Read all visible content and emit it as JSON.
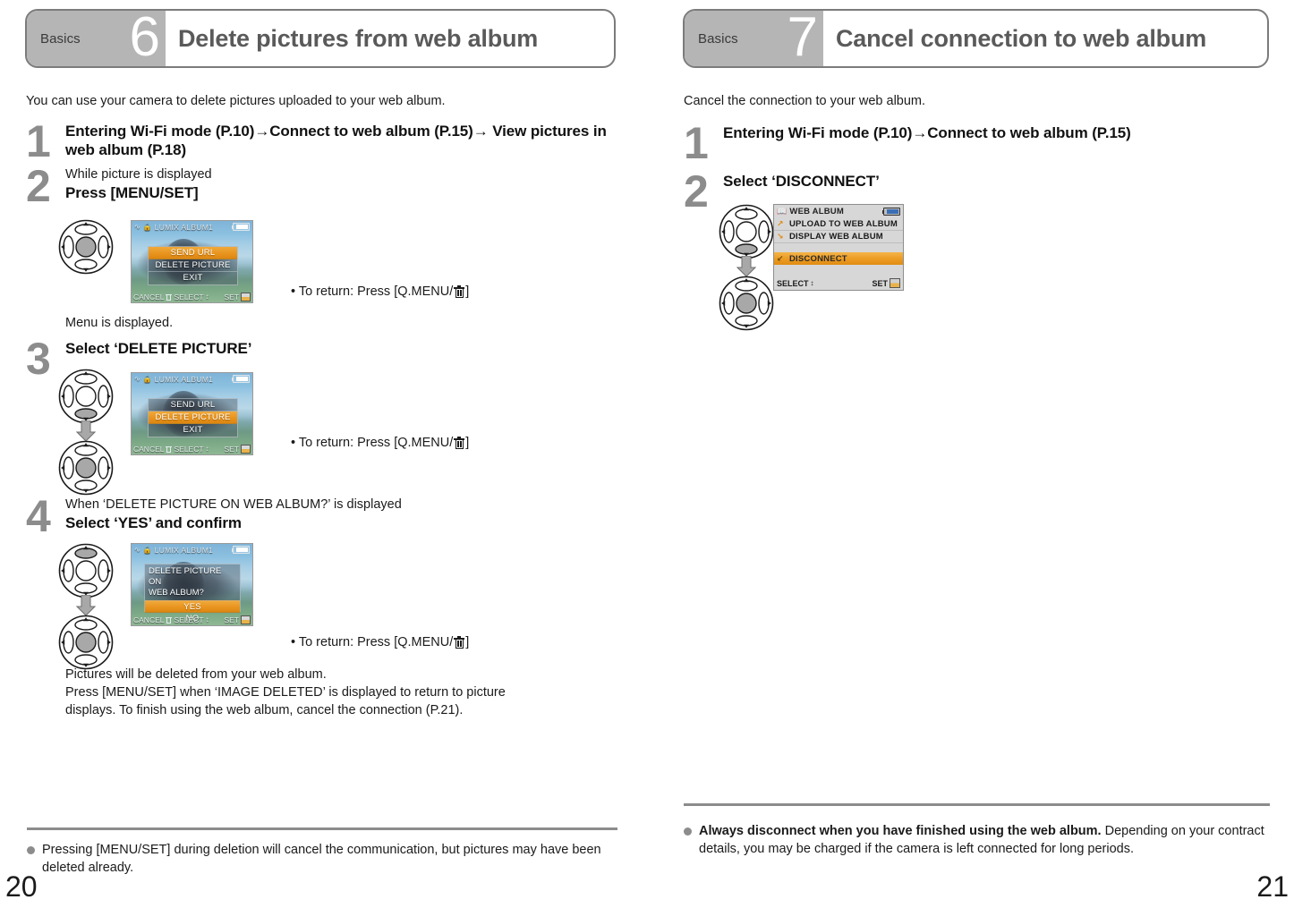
{
  "left_page": {
    "banner": {
      "category": "Basics",
      "number": "6",
      "title": "Delete pictures from web album"
    },
    "intro": "You can use your camera to delete pictures uploaded to your web album.",
    "steps": [
      {
        "num": "1",
        "sub": "",
        "main": "Entering Wi-Fi mode (P.10)→Connect to web album (P.15)→ View pictures in web album (P.18)"
      },
      {
        "num": "2",
        "sub": "While picture is displayed",
        "main": "Press [MENU/SET]"
      },
      {
        "num": "3",
        "sub": "",
        "main": "Select ‘DELETE PICTURE’"
      },
      {
        "num": "4",
        "sub": "When ‘DELETE PICTURE ON WEB ALBUM?’ is displayed",
        "main": "Select ‘YES’ and confirm"
      }
    ],
    "after_step2_note": "Menu is displayed.",
    "return_notes": [
      "• To return: Press [Q.MENU/",
      "• To return: Press [Q.MENU/",
      "• To return: Press [Q.MENU/"
    ],
    "return_note_tail": "]",
    "closing_lines": [
      "Pictures will be deleted from your web album.",
      "Press [MENU/SET] when ‘IMAGE DELETED’ is displayed to return to picture",
      "displays. To finish using the web album, cancel the connection (P.21)."
    ],
    "footer_note": {
      "strong": "",
      "text": "Pressing [MENU/SET] during deletion will cancel the communication, but pictures may have been deleted already."
    },
    "page_number": "20",
    "lcd_menu": {
      "title": "LUMIX ALBUM1",
      "items": [
        "SEND URL",
        "DELETE PICTURE",
        "EXIT"
      ],
      "selected_step2": "SEND URL",
      "selected_step3": "DELETE PICTURE",
      "bottom_cancel": "CANCEL",
      "bottom_select": "SELECT",
      "bottom_set": "SET"
    },
    "lcd_confirm": {
      "title": "LUMIX ALBUM1",
      "question_line1": "DELETE PICTURE ON",
      "question_line2": "WEB ALBUM?",
      "options": [
        "YES",
        "NO"
      ],
      "selected": "YES",
      "bottom_cancel": "CANCEL",
      "bottom_select": "SELECT",
      "bottom_set": "SET"
    }
  },
  "right_page": {
    "banner": {
      "category": "Basics",
      "number": "7",
      "title": "Cancel connection to web album"
    },
    "intro": "Cancel the connection to your web album.",
    "steps": [
      {
        "num": "1",
        "sub": "",
        "main": "Entering Wi-Fi mode (P.10)→Connect to web album (P.15)"
      },
      {
        "num": "2",
        "sub": "",
        "main": "Select ‘DISCONNECT’"
      }
    ],
    "lcd_menu": {
      "title": "WEB ALBUM",
      "rows": [
        "UPLOAD TO WEB ALBUM",
        "DISPLAY WEB ALBUM"
      ],
      "selected": "DISCONNECT",
      "bottom_select": "SELECT",
      "bottom_set": "SET"
    },
    "footer_note": {
      "strong": "Always disconnect when you have finished using the web album.",
      "text": " Depending on your contract details, you may be charged if the camera is left connected for long periods."
    },
    "page_number": "21"
  },
  "colors": {
    "banner_gray": "#b5b5b5",
    "banner_border": "#7b7b7b",
    "title_gray": "#5a5a5a",
    "step_num_gray": "#8c8c8c",
    "highlight_orange": "#e8941f",
    "rule_gray": "#8c8c8c"
  }
}
